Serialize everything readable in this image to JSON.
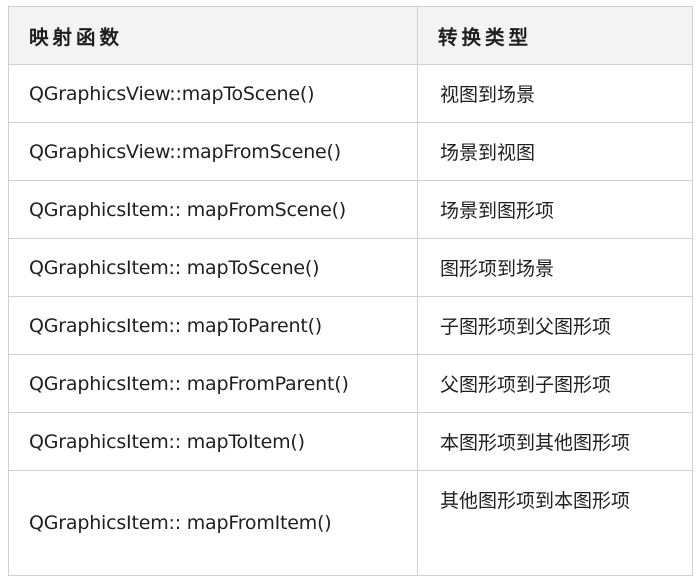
{
  "table": {
    "headers": {
      "function": "映射函数",
      "conversion": "转换类型"
    },
    "rows": [
      {
        "function": "QGraphicsView::mapToScene()",
        "conversion": "视图到场景"
      },
      {
        "function": "QGraphicsView::mapFromScene()",
        "conversion": "场景到视图"
      },
      {
        "function": "QGraphicsItem:: mapFromScene()",
        "conversion": "场景到图形项"
      },
      {
        "function": "QGraphicsItem:: mapToScene()",
        "conversion": "图形项到场景"
      },
      {
        "function": "QGraphicsItem:: mapToParent()",
        "conversion": "子图形项到父图形项"
      },
      {
        "function": "QGraphicsItem:: mapFromParent()",
        "conversion": "父图形项到子图形项"
      },
      {
        "function": "QGraphicsItem:: mapToItem()",
        "conversion": "本图形项到其他图形项"
      },
      {
        "function": "QGraphicsItem:: mapFromItem()",
        "conversion": "其他图形项到本图形项"
      }
    ]
  },
  "colors": {
    "header_background": "#f3f3f3",
    "border": "#cfcfcf",
    "text": "#1f1f1f"
  }
}
